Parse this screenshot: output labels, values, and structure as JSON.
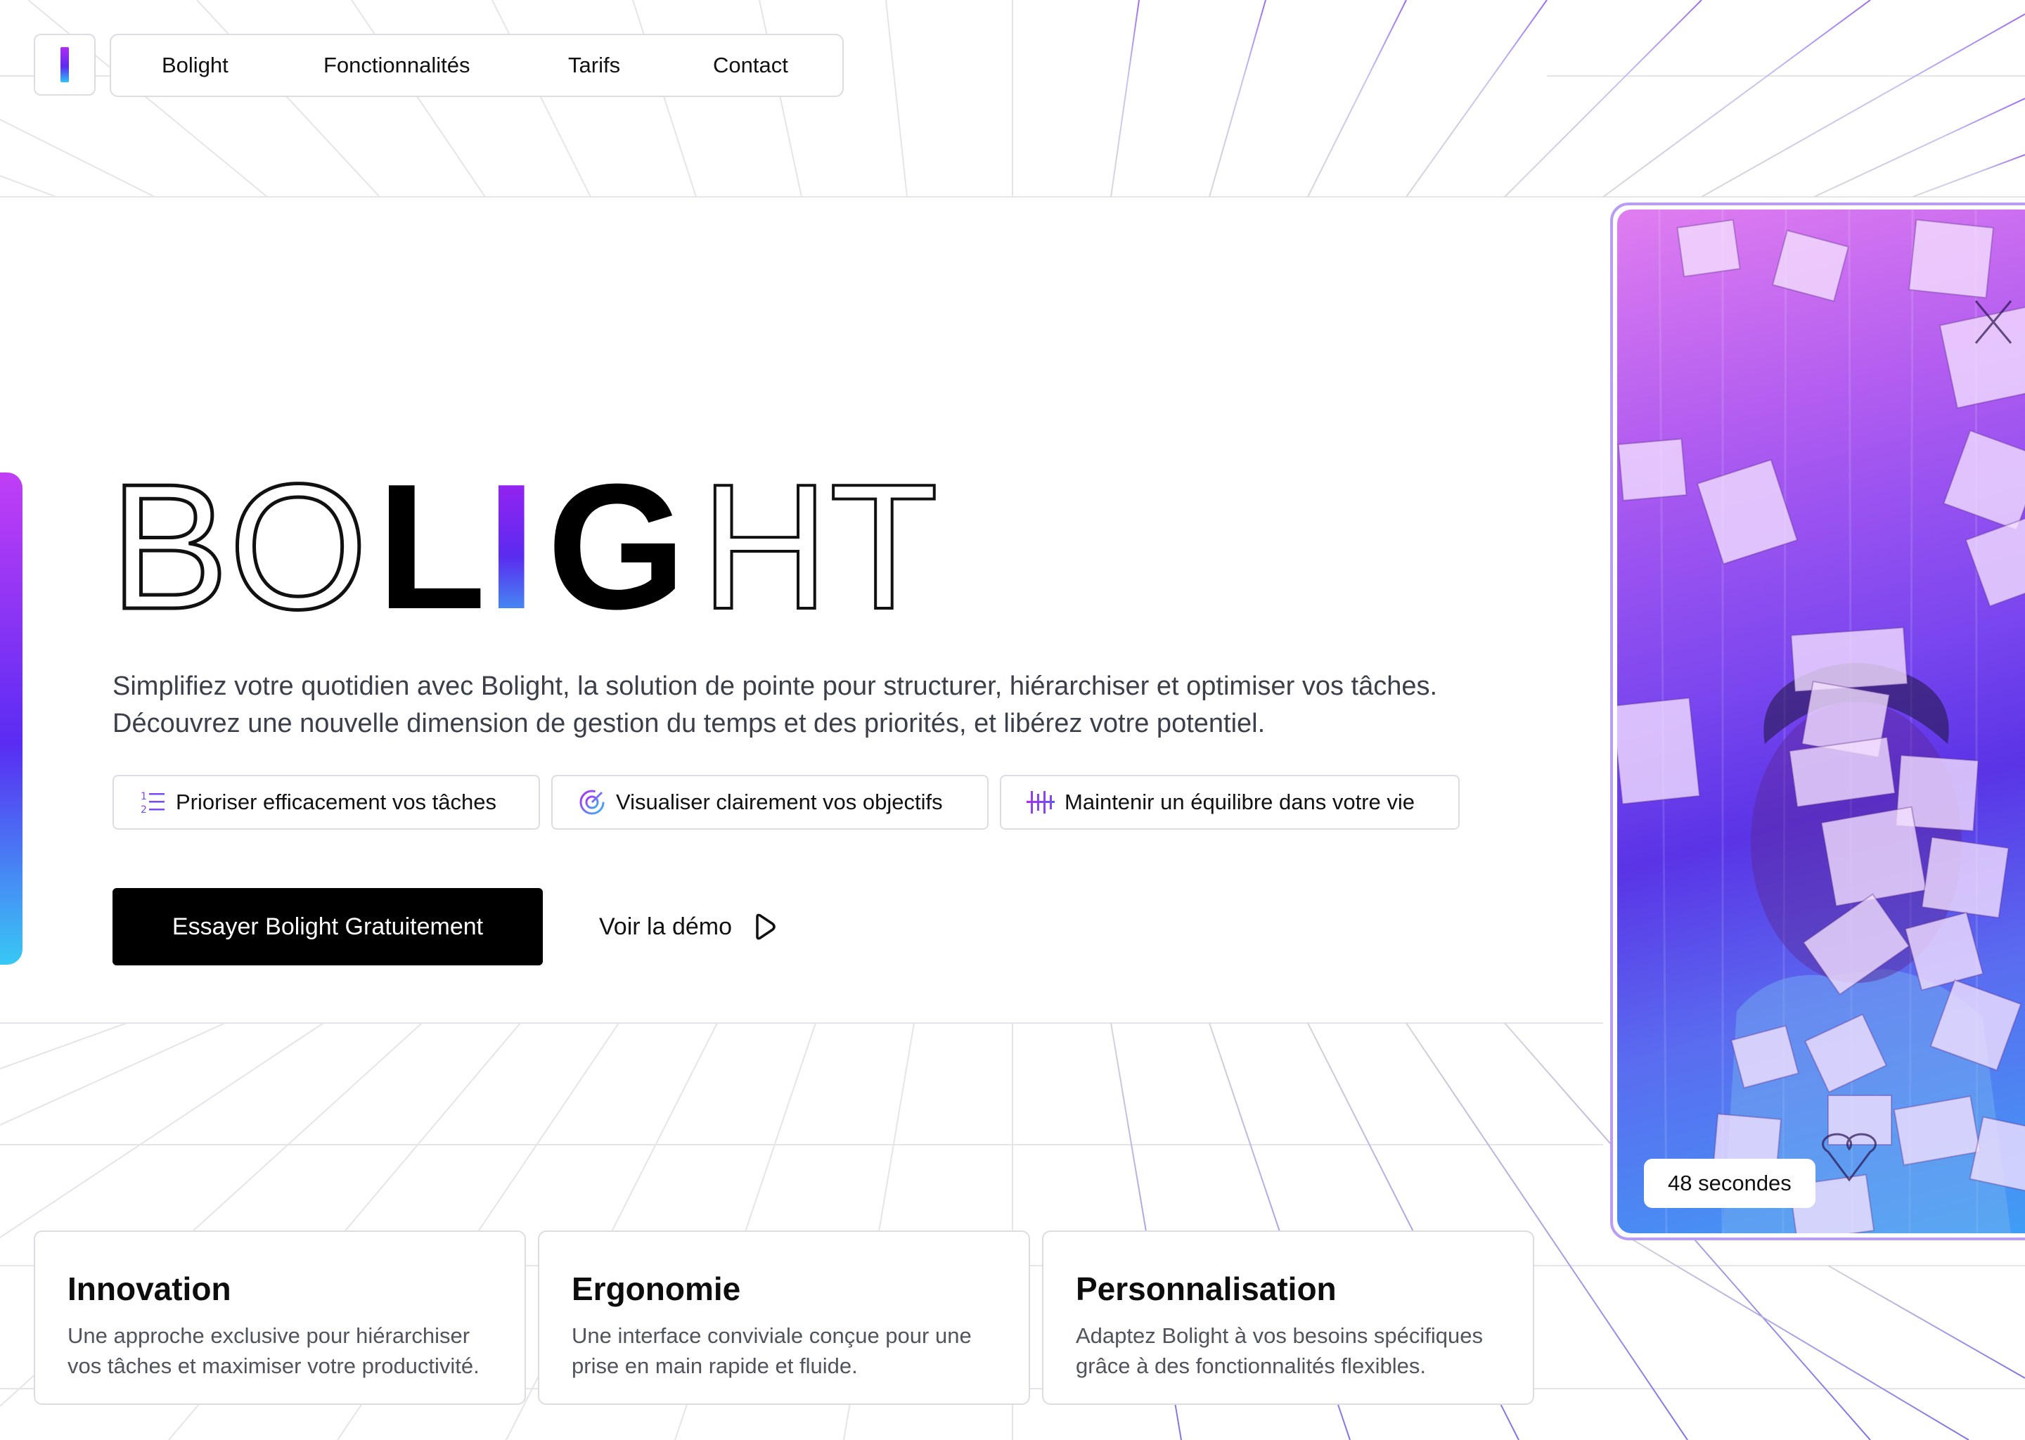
{
  "nav": {
    "logo_icon": "gradient-bar-logo",
    "items": [
      {
        "label": "Bolight"
      },
      {
        "label": "Fonctionnalités"
      },
      {
        "label": "Tarifs"
      },
      {
        "label": "Contact"
      }
    ]
  },
  "hero": {
    "brand": "BOLIGHT",
    "brand_parts": [
      "BO",
      "L",
      "I",
      "G",
      "HT"
    ],
    "description": "Simplifiez votre quotidien avec Bolight, la solution de pointe pour structurer, hiérarchiser et optimiser vos tâches. Découvrez une nouvelle dimension de gestion du temps et des priorités, et libérez votre potentiel.",
    "chips": [
      {
        "icon": "numbered-list-icon",
        "label": "Prioriser efficacement vos tâches"
      },
      {
        "icon": "target-icon",
        "label": "Visualiser clairement vos objectifs"
      },
      {
        "icon": "balance-lines-icon",
        "label": "Maintenir un équilibre dans votre vie"
      }
    ],
    "cta_label": "Essayer Bolight Gratuitement",
    "demo_label": "Voir la démo",
    "demo_icon": "play-icon"
  },
  "media": {
    "duration_label": "48 secondes",
    "photo_icon": "sticky-notes-photo"
  },
  "features": [
    {
      "title": "Innovation",
      "text": "Une approche exclusive pour hiérarchiser vos tâches et maximiser votre productivité."
    },
    {
      "title": "Ergonomie",
      "text": "Une interface conviviale conçue pour une prise en main rapide et fluide."
    },
    {
      "title": "Personnalisation",
      "text": "Adaptez Bolight à vos besoins spécifiques grâce à des fonctionnalités flexibles."
    }
  ],
  "colors": {
    "accent_purple": "#b02cf5",
    "accent_indigo": "#5b2bf0",
    "accent_cyan": "#2ec4f5",
    "cta_background": "#000000",
    "border": "#dcdde3",
    "text_muted": "#50545e"
  }
}
